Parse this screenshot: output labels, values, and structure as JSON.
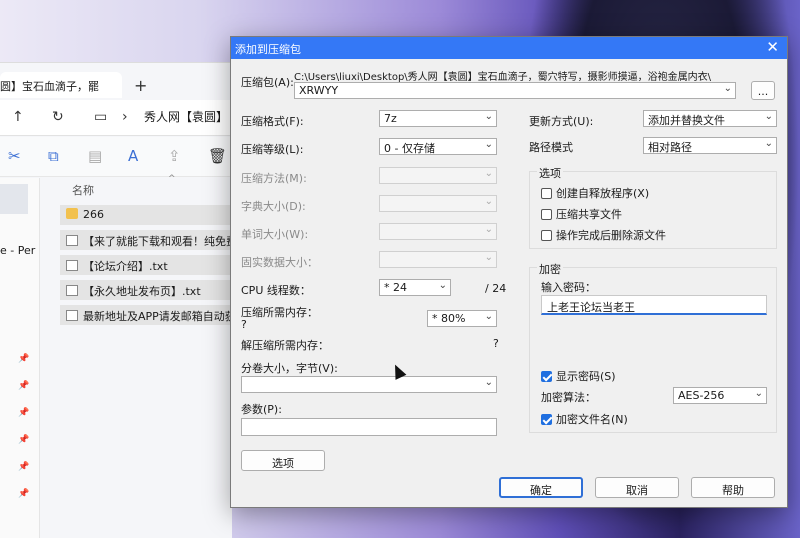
{
  "explorer": {
    "tab_title": "圆】宝石血滴子，罷",
    "path": "秀人网【袁圆】",
    "column_name": "名称",
    "left_label": "e - Per",
    "files": [
      "266",
      "【来了就能下载和观看！纯免费!",
      "【论坛介绍】.txt",
      "【永久地址发布页】.txt",
      "最新地址及APP请发邮箱自动获取"
    ]
  },
  "dialog": {
    "title": "添加到压缩包",
    "archive_label": "压缩包(A):",
    "archive_path": "C:\\Users\\liuxi\\Desktop\\秀人网【袁圆】宝石血滴子，蜀穴特写，摄影师摸逼，浴袍金属内衣\\",
    "archive_name": "XRWYY",
    "browse": "...",
    "format_label": "压缩格式(F):",
    "format_value": "7z",
    "level_label": "压缩等级(L):",
    "level_value": "0 - 仅存储",
    "method_label": "压缩方法(M):",
    "dict_label": "字典大小(D):",
    "word_label": "单词大小(W):",
    "solid_label": "固实数据大小：",
    "cpu_label": "CPU 线程数：",
    "cpu_value": "* 24",
    "cpu_total": "/ 24",
    "mem_comp_label": "压缩所需内存：",
    "mem_comp_q": "?",
    "mem_comp_value": "* 80%",
    "mem_decomp_label": "解压缩所需内存：",
    "mem_decomp_value": "?",
    "volume_label": "分卷大小，字节(V):",
    "params_label": "参数(P):",
    "options_button": "选项",
    "update_label": "更新方式(U):",
    "update_value": "添加并替换文件",
    "path_mode_label": "路径模式",
    "path_mode_value": "相对路径",
    "options_group": "选项",
    "opt_sfx": "创建自释放程序(X)",
    "opt_shared": "压缩共享文件",
    "opt_delete": "操作完成后删除源文件",
    "encrypt_group": "加密",
    "password_label": "输入密码：",
    "password_value": "上老王论坛当老王",
    "show_password": "显示密码(S)",
    "enc_method_label": "加密算法：",
    "enc_method_value": "AES-256",
    "enc_names": "加密文件名(N)",
    "ok": "确定",
    "cancel": "取消",
    "help": "帮助"
  },
  "icons": {
    "close": "close-icon",
    "dropdown": "chevron-down-icon"
  }
}
